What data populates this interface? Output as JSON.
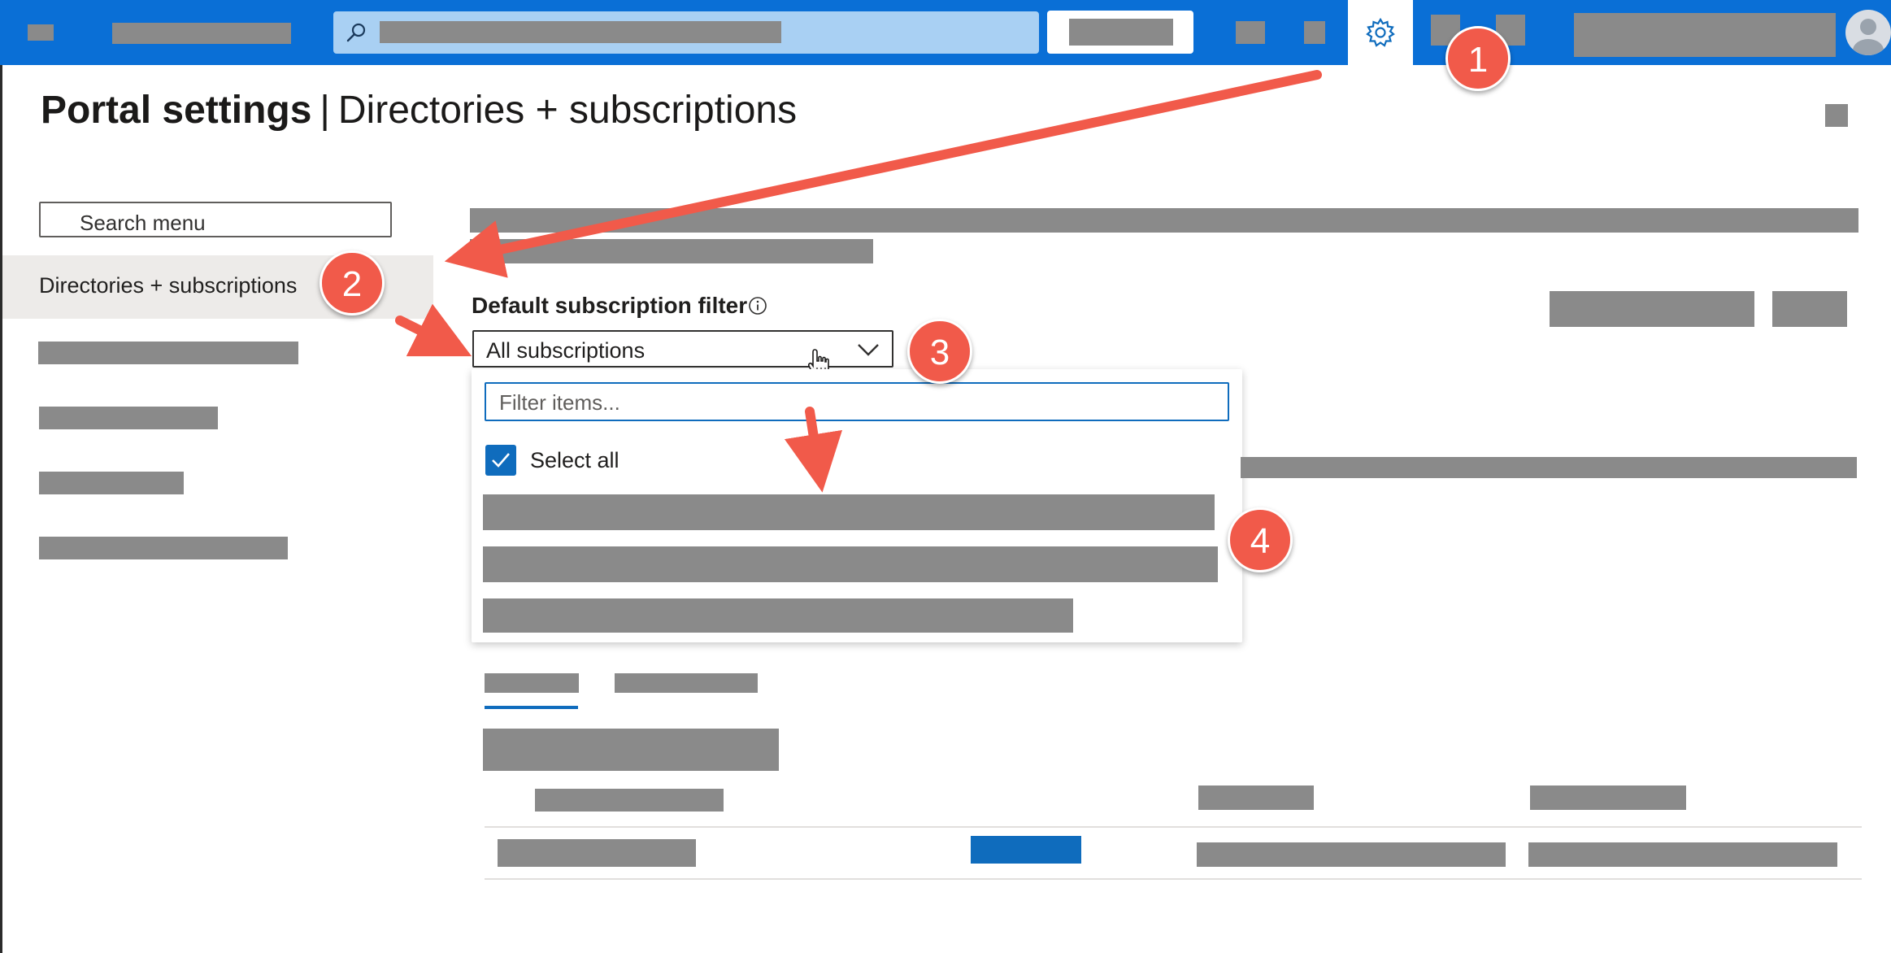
{
  "page": {
    "title_bold": "Portal settings",
    "title_separator": "|",
    "title_sub": "Directories + subscriptions"
  },
  "sidebar": {
    "search_placeholder": "Search menu",
    "selected_item": "Directories + subscriptions"
  },
  "main": {
    "filter_label": "Default subscription filter",
    "dropdown_value": "All subscriptions",
    "dropdown_panel": {
      "filter_placeholder": "Filter items...",
      "select_all_label": "Select all",
      "select_all_checked": true
    }
  },
  "annotations": [
    "1",
    "2",
    "3",
    "4"
  ],
  "icons": {
    "search": "search-icon",
    "settings": "gear-icon",
    "info": "info-icon",
    "dropdown": "chevron-down-icon",
    "cursor": "hand-cursor-icon",
    "avatar": "avatar-icon",
    "checkbox": "checkmark-icon"
  },
  "colors": {
    "topbar": "#0a6fd6",
    "accent": "#0f6cbd",
    "annotation": "#f15a4a",
    "redaction": "#8a8a8a",
    "selected_menu_bg": "#edebe9"
  }
}
